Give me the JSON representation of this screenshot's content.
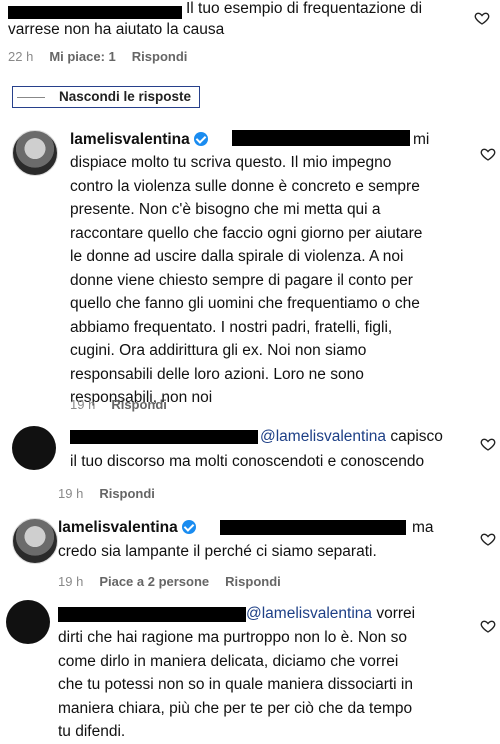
{
  "top": {
    "line1_after_redaction": "Il tuo esempio di frequentazione di",
    "line2": "varrese non ha aiutato la causa",
    "time": "22 h",
    "likes": "Mi piace: 1",
    "reply": "Rispondi",
    "hide_replies": "Nascondi le risposte"
  },
  "c1": {
    "username": "lamelisvalentina",
    "after_redaction": "mi",
    "lines": [
      "dispiace molto tu scriva questo. Il mio impegno",
      "contro la violenza sulle donne è concreto e sempre",
      "presente. Non c'è bisogno che mi metta qui a",
      "raccontare quello che faccio ogni giorno per aiutare",
      "le donne ad uscire dalla spirale di violenza. A noi",
      "donne viene chiesto sempre di pagare il conto per",
      "quello che fanno gli uomini che frequentiamo o che",
      "abbiamo frequentato. I nostri padri, fratelli, figli,",
      "cugini. Ora addirittura gli ex. Noi non siamo",
      "responsabili delle loro azioni. Loro ne sono",
      "responsabili, non noi"
    ],
    "time": "19 h",
    "reply": "Rispondi"
  },
  "c2": {
    "mention": "@lamelisvalentina",
    "after_mention": "capisco",
    "line2": "il tuo discorso ma molti conoscendoti e conoscendo",
    "time": "19 h",
    "reply": "Rispondi"
  },
  "c3": {
    "username": "lamelisvalentina",
    "after_redaction": "ma",
    "line2": "credo sia lampante il perché ci siamo separati.",
    "time": "19 h",
    "likes": "Piace a 2 persone",
    "reply": "Rispondi"
  },
  "c4": {
    "mention": "@lamelisvalentina",
    "after_mention": "vorrei",
    "lines": [
      "dirti che hai ragione ma purtroppo non lo è. Non so",
      "come dirlo in maniera delicata, diciamo che vorrei",
      "che tu potessi non so in quale maniera dissociarti in",
      "maniera chiara, più che per te per ciò che da tempo",
      "tu difendi."
    ]
  },
  "icons": {
    "like": "heart-outline-icon",
    "verified": "verified-badge-icon"
  }
}
